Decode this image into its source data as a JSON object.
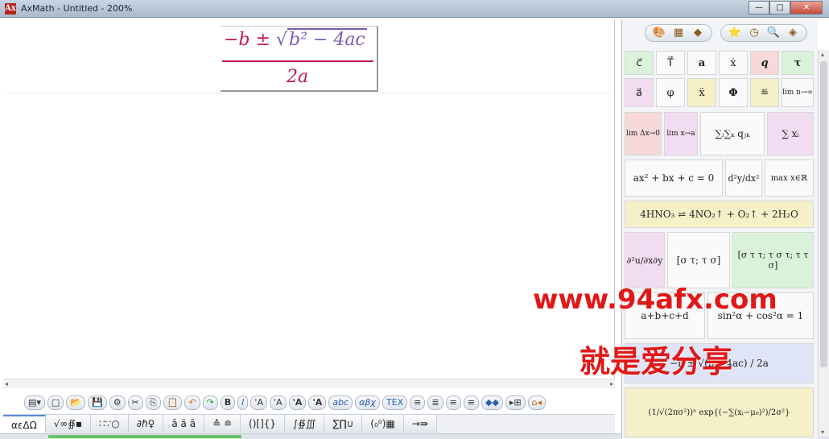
{
  "window": {
    "title": "AxMath - Untitled - 200%",
    "icon": "Ax",
    "minimize": "—",
    "maximize": "□",
    "close": "✕"
  },
  "formula": {
    "neg_b": "−b",
    "plus_minus": "±",
    "sqrt": "√",
    "b2": "b² − 4ac",
    "denominator": "2a"
  },
  "toolbar": {
    "items": [
      "▤▾",
      "□",
      "📂",
      "💾",
      "⚙",
      "✂",
      "⎘",
      "📋",
      "↶",
      "↷",
      "B",
      "I",
      "'A",
      "'A",
      "'A",
      "'A",
      "abc",
      "αβχ",
      "TEX",
      "≡",
      "≣",
      "≡",
      "≡",
      "◆◆",
      "▸⊞",
      "⌂◂"
    ]
  },
  "tabs": [
    "αεΔΩ",
    "√∞∯▪",
    "∷∵○",
    "∂ℏ♀",
    "â ä ā",
    "≙ ≘",
    "()[]{}",
    "∫∯∭",
    "∑∏∪",
    "(₀⁰)▦",
    "→⇛"
  ],
  "sidebar": {
    "top_icons": [
      "🎨",
      "▦",
      "◆"
    ],
    "top_icons2": [
      "⭐",
      "◷",
      "🔍",
      "◈"
    ],
    "row1": [
      "c⃗",
      "T⃗",
      "a",
      "ẋ",
      "q",
      "τ"
    ],
    "row2": [
      "a⃗",
      "φ",
      "ẍ",
      "Φ",
      "≝",
      "lim n→∞"
    ],
    "row3": [
      "lim Δx→0",
      "lim x→a",
      "∑ᵢ∑ₖ qⱼₖ",
      "∑ xᵢ"
    ],
    "row4": [
      "ax² + bx + c = 0",
      "d²y/dx²",
      "max x∈ℝ"
    ],
    "row5": "4HNO₃ ⇌ 4NO₂↑ + O₂↑ + 2H₂O",
    "row6": [
      "∂²u/∂x∂y",
      "[σ τ; τ σ]",
      "[σ τ τ; τ σ τ; τ τ σ]"
    ],
    "row7": [
      "a+b+c+d",
      "sin²α + cos²α = 1"
    ],
    "row8": "−b ± √(b²−4ac) / 2a",
    "row9": "(1/√(2πσ²))ⁿ exp{(−∑(xᵢ−μ₀)²)/2σ²}"
  },
  "watermark": {
    "url": "www.94afx.com",
    "slogan": "就是爱分享"
  }
}
